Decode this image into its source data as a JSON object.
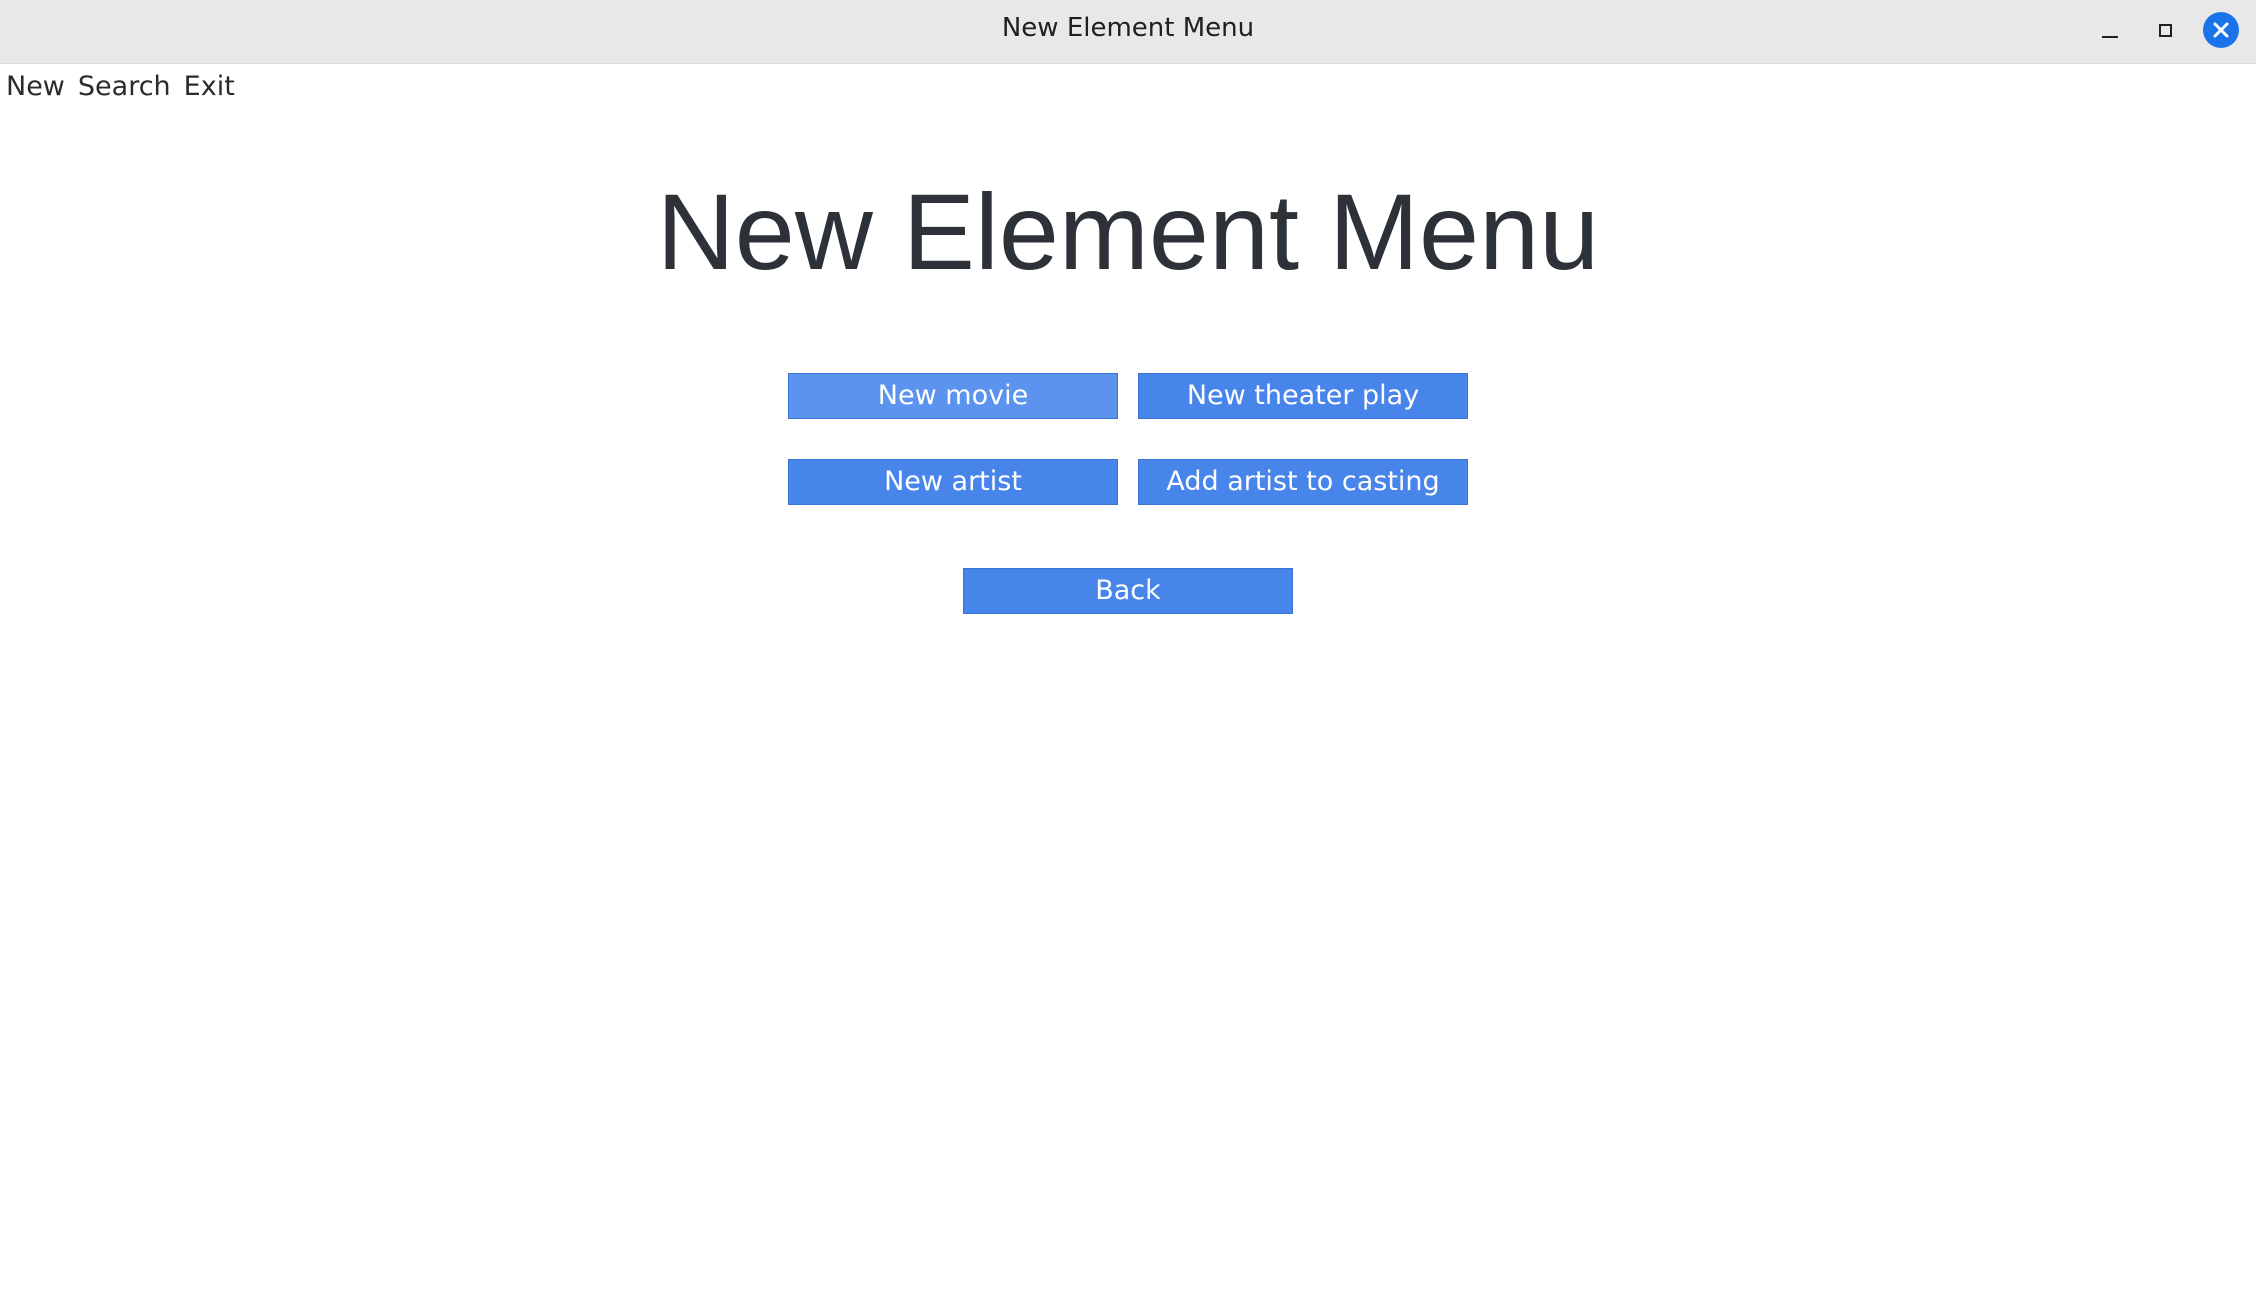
{
  "window": {
    "title": "New Element Menu"
  },
  "menubar": {
    "items": [
      {
        "label": "New"
      },
      {
        "label": "Search"
      },
      {
        "label": "Exit"
      }
    ]
  },
  "main": {
    "heading": "New Element Menu",
    "buttons": {
      "new_movie": "New movie",
      "new_theater_play": "New theater play",
      "new_artist": "New artist",
      "add_artist_to_casting": "Add artist to casting",
      "back": "Back"
    }
  },
  "colors": {
    "button_bg": "#4785eb",
    "button_hover_bg": "#5b93ee",
    "button_text": "#ffffff",
    "close_button": "#1a73e8",
    "heading_text": "#2c3237"
  },
  "icons": {
    "minimize": "minimize-icon",
    "maximize": "maximize-icon",
    "close": "close-icon"
  }
}
